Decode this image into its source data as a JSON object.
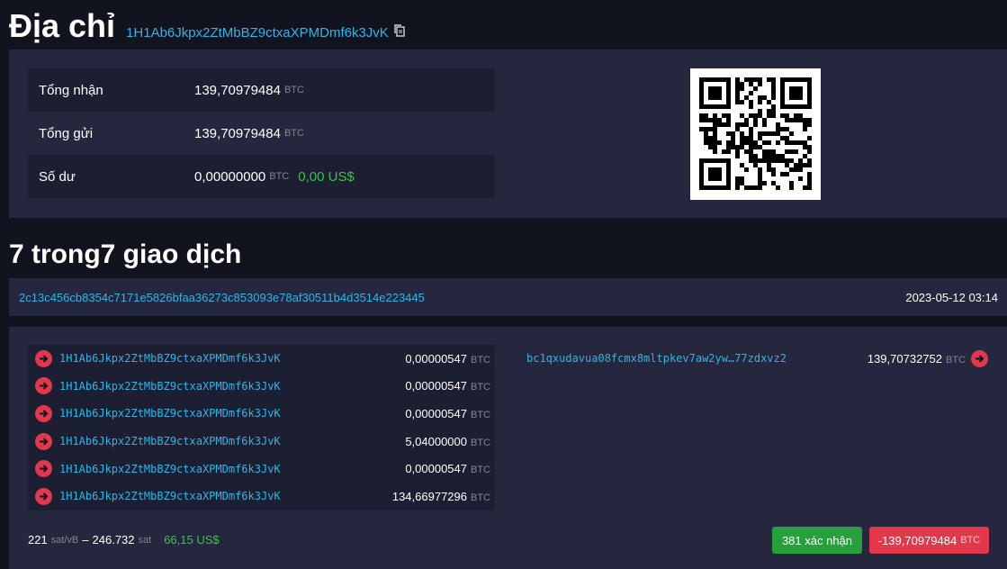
{
  "header": {
    "title": "Địa chỉ",
    "address": "1H1Ab6Jkpx2ZtMbBZ9ctxaXPMDmf6k3JvK",
    "copy_icon": "copy-icon"
  },
  "summary": {
    "total_received_label": "Tổng nhận",
    "total_received_value": "139,70979484",
    "total_sent_label": "Tổng gửi",
    "total_sent_value": "139,70979484",
    "balance_label": "Số dư",
    "balance_value": "0,00000000",
    "balance_usd": "0,00 US$",
    "unit": "BTC"
  },
  "transactions": {
    "heading": "7 trong7 giao dịch",
    "hash": "2c13c456cb8354c7171e5826bfaa36273c853093e78af30511b4d3514e223445",
    "timestamp": "2023-05-12 03:14",
    "inputs": [
      {
        "address": "1H1Ab6Jkpx2ZtMbBZ9ctxaXPMDmf6k3JvK",
        "amount": "0,00000547"
      },
      {
        "address": "1H1Ab6Jkpx2ZtMbBZ9ctxaXPMDmf6k3JvK",
        "amount": "0,00000547"
      },
      {
        "address": "1H1Ab6Jkpx2ZtMbBZ9ctxaXPMDmf6k3JvK",
        "amount": "0,00000547"
      },
      {
        "address": "1H1Ab6Jkpx2ZtMbBZ9ctxaXPMDmf6k3JvK",
        "amount": "5,04000000"
      },
      {
        "address": "1H1Ab6Jkpx2ZtMbBZ9ctxaXPMDmf6k3JvK",
        "amount": "0,00000547"
      },
      {
        "address": "1H1Ab6Jkpx2ZtMbBZ9ctxaXPMDmf6k3JvK",
        "amount": "134,66977296"
      }
    ],
    "output": {
      "address": "bc1qxudavua08fcmx8mltpkev7aw2yw…77zdxvz2",
      "amount": "139,70732752"
    },
    "fee_rate": "221",
    "fee_rate_unit": "sat/vB",
    "fee_sep": "–",
    "fee_total": "246.732",
    "fee_unit": "sat",
    "fee_usd": "66,15 US$",
    "confirmations": "381 xác nhận",
    "net_amount": "-139,70979484",
    "unit": "BTC"
  },
  "colors": {
    "background": "#11131f",
    "panel": "#24273d",
    "link": "#2fb5e6",
    "green": "#25a03d",
    "red": "#e3374b"
  }
}
